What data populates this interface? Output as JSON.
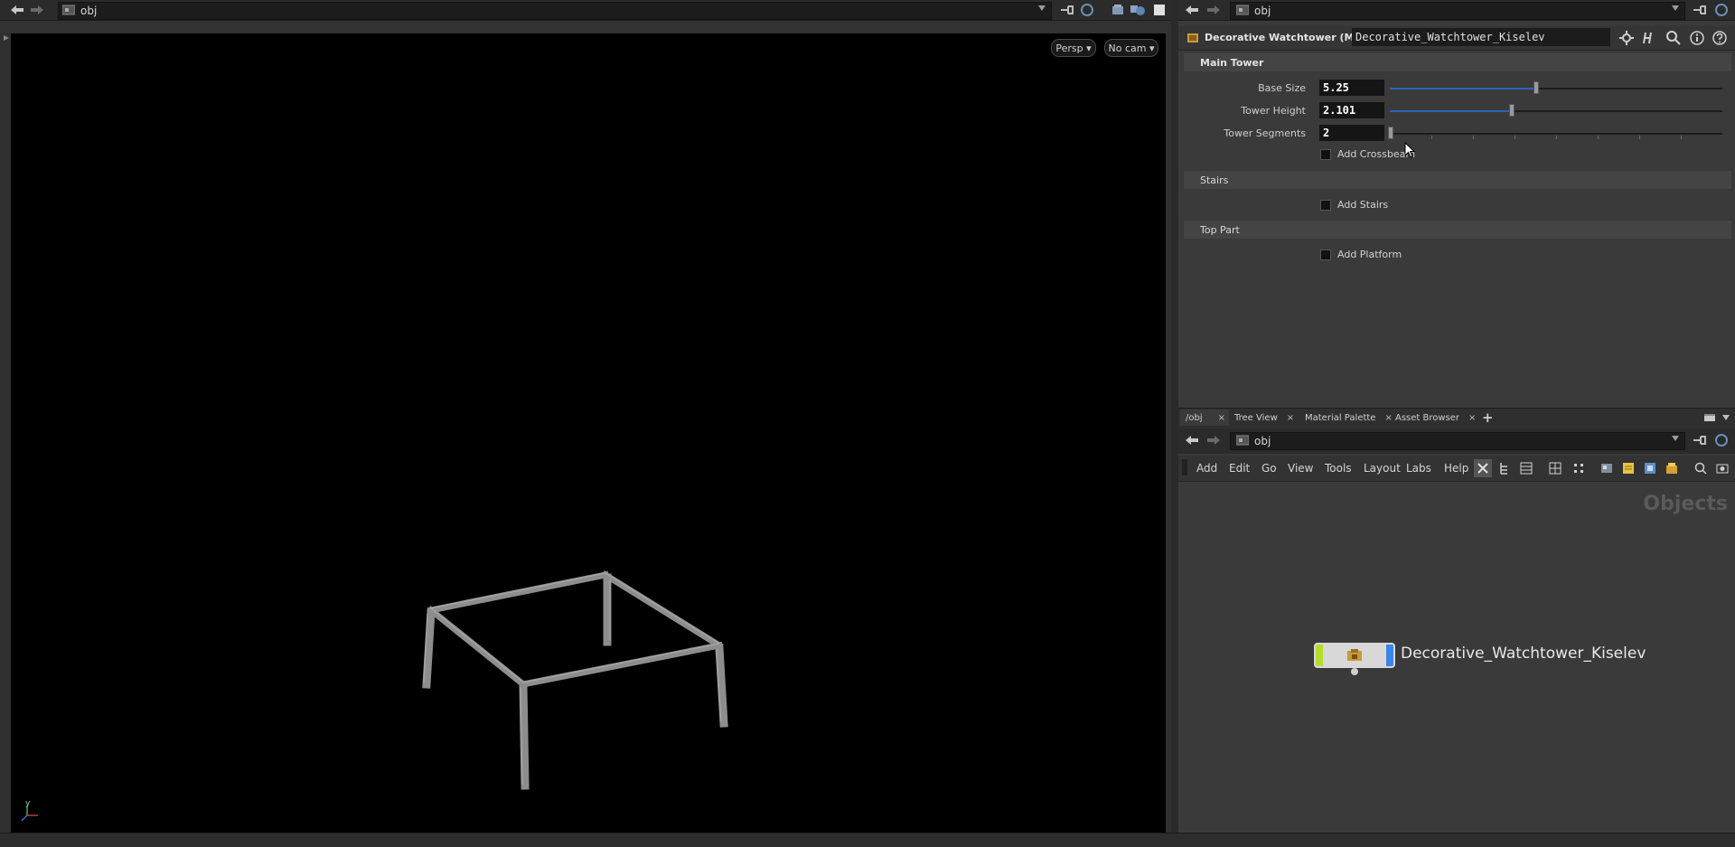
{
  "viewport_pane": {
    "path": "obj",
    "camera_menu": "Persp ▾",
    "cam_menu": "No cam ▾",
    "axis_y": "y"
  },
  "parameter_pane": {
    "path": "obj",
    "node_type_label": "Decorative Watchtower (Main)",
    "node_name": "Decorative_Watchtower_Kiselev",
    "folders": {
      "main_tower": "Main Tower",
      "stairs": "Stairs",
      "top_part": "Top Part"
    },
    "params": {
      "base_size": {
        "label": "Base Size",
        "value": "5.25",
        "slider_fraction": 0.44
      },
      "tower_height": {
        "label": "Tower Height",
        "value": "2.101",
        "slider_fraction": 0.365
      },
      "tower_segments": {
        "label": "Tower Segments",
        "value": "2",
        "slider_fraction": 0.0
      }
    },
    "toggles": {
      "add_crossbeam": {
        "label": "Add Crossbeam",
        "checked": false
      },
      "add_stairs": {
        "label": "Add Stairs",
        "checked": false
      },
      "add_platform": {
        "label": "Add Platform",
        "checked": false
      }
    }
  },
  "network_pane": {
    "tabs": [
      {
        "label": "/obj",
        "active": true
      },
      {
        "label": "Tree View",
        "active": false
      },
      {
        "label": "Material Palette",
        "active": false
      },
      {
        "label": "Asset Browser",
        "active": false
      }
    ],
    "add_tab": "+",
    "path": "obj",
    "menus": [
      "Add",
      "Edit",
      "Go",
      "View",
      "Tools",
      "Layout",
      "Labs",
      "Help"
    ],
    "context_label": "Objects",
    "node": {
      "name": "Decorative_Watchtower_Kiselev"
    }
  },
  "colors": {
    "accent_blue": "#2b63b8",
    "node_green": "#b6dc2c",
    "node_blue": "#3a86e8",
    "node_icon": "#c89a3a"
  }
}
